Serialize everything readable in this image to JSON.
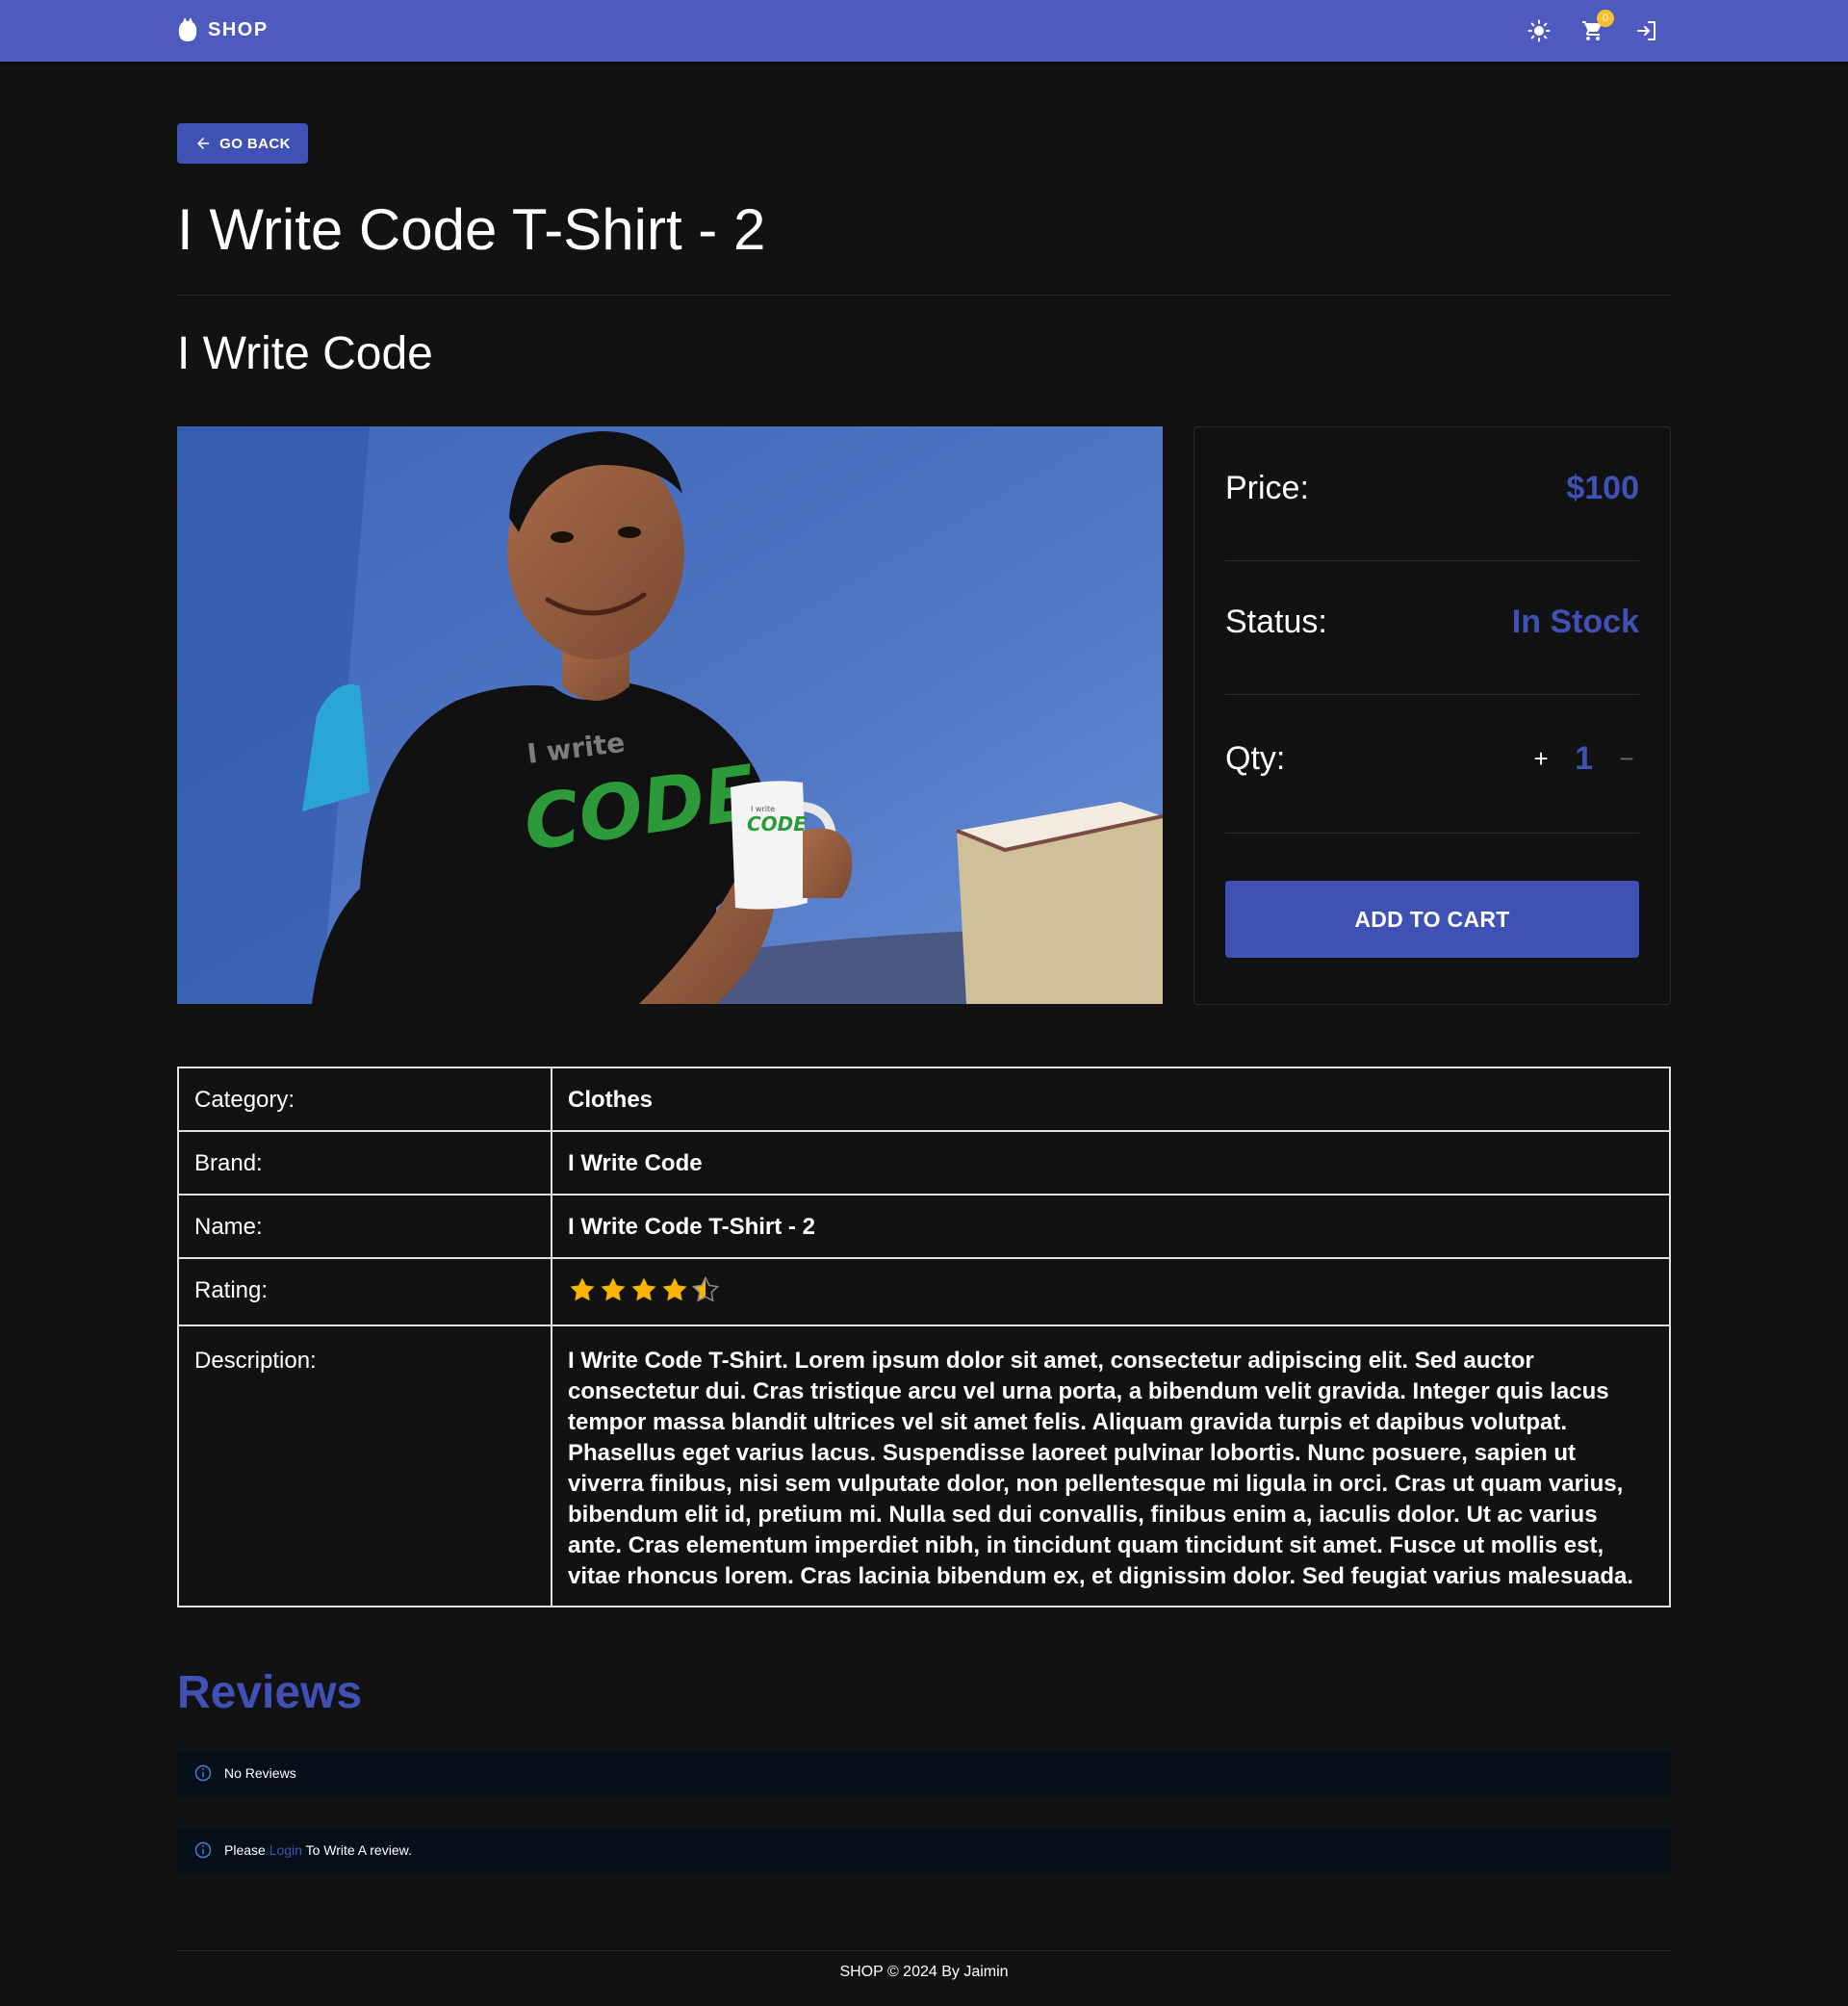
{
  "header": {
    "brand": "SHOP",
    "cart_count": "0",
    "icons": [
      "brightness-icon",
      "cart-icon",
      "login-icon"
    ],
    "color": "#4e5bbe"
  },
  "go_back": {
    "label": "GO BACK",
    "icon": "arrow-left-icon"
  },
  "product": {
    "title": "I Write Code T-Shirt - 2",
    "brand_heading": "I Write Code",
    "image": {
      "shirt_text_small": "I write",
      "shirt_text_big": "CODE",
      "mug_text_small": "I write",
      "mug_text_big": "CODE"
    }
  },
  "buy_box": {
    "price_label": "Price:",
    "price_value": "$100",
    "status_label": "Status:",
    "status_value": "In Stock",
    "qty_label": "Qty:",
    "qty_value": "1",
    "plus_symbol": "+",
    "minus_symbol": "−",
    "add_to_cart": "ADD TO CART",
    "accent_color": "#3f51b5"
  },
  "details": {
    "category_label": "Category:",
    "category_value": "Clothes",
    "brand_label": "Brand:",
    "brand_value": "I Write Code",
    "name_label": "Name:",
    "name_value": "I Write Code T-Shirt - 2",
    "rating_label": "Rating:",
    "rating_value": 4.5,
    "rating_max": 5,
    "star_color": "#f7b500",
    "description_label": "Description:",
    "description_value": "I Write Code T-Shirt. Lorem ipsum dolor sit amet, consectetur adipiscing elit. Sed auctor consectetur dui. Cras tristique arcu vel urna porta, a bibendum velit gravida. Integer quis lacus tempor massa blandit ultrices vel sit amet felis. Aliquam gravida turpis et dapibus volutpat. Phasellus eget varius lacus. Suspendisse laoreet pulvinar lobortis. Nunc posuere, sapien ut viverra finibus, nisi sem vulputate dolor, non pellentesque mi ligula in orci. Cras ut quam varius, bibendum elit id, pretium mi. Nulla sed dui convallis, finibus enim a, iaculis dolor. Ut ac varius ante. Cras elementum imperdiet nibh, in tincidunt quam tincidunt sit amet. Fusce ut mollis est, vitae rhoncus lorem. Cras lacinia bibendum ex, et dignissim dolor. Sed feugiat varius malesuada."
  },
  "reviews": {
    "title": "Reviews",
    "no_reviews": "No Reviews",
    "login_prefix": "Please",
    "login_link": "Login",
    "login_suffix": "To Write A review.",
    "info_icon": "info-icon"
  },
  "footer": {
    "text": "SHOP © 2024 By Jaimin"
  }
}
